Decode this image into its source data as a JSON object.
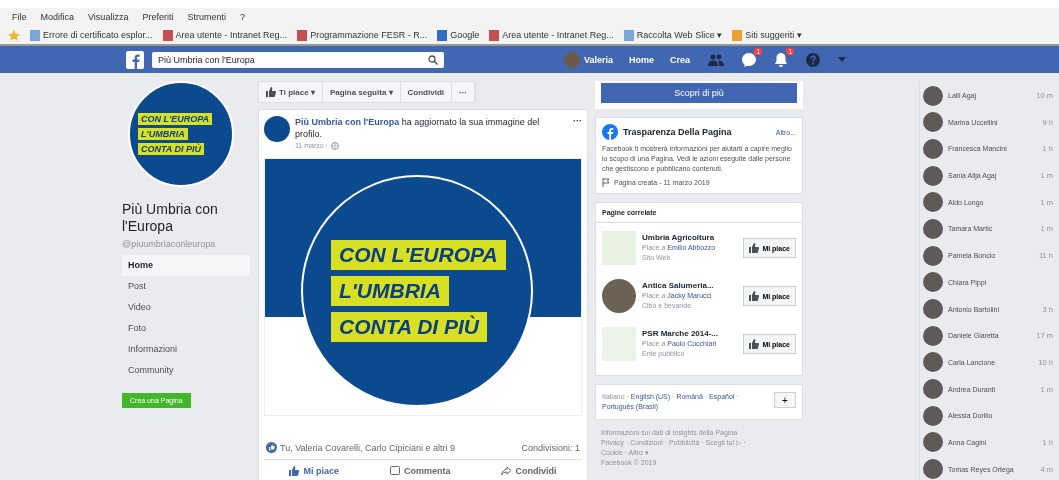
{
  "menu_bar": [
    "File",
    "Modifica",
    "Visualizza",
    "Preferiti",
    "Strumenti",
    "?"
  ],
  "favorites_bar": [
    {
      "kind": "page",
      "label": "Errore di certificato esplor..."
    },
    {
      "kind": "doc",
      "label": "Area utente - Intranet Reg..."
    },
    {
      "kind": "doc",
      "label": "Programmazione FESR - R..."
    },
    {
      "kind": "google",
      "label": "Google"
    },
    {
      "kind": "doc",
      "label": "Area utente - Intranet Reg..."
    },
    {
      "kind": "slice",
      "label": "Raccolta Web Slice ▾"
    },
    {
      "kind": "suggest",
      "label": "Siti suggeriti ▾"
    }
  ],
  "fb_bar": {
    "search": "Più Umbria con l'Europa",
    "user": "Valeria",
    "links": [
      "Home",
      "Crea"
    ],
    "messages_badge": "1",
    "notifications_badge": "1"
  },
  "page": {
    "logo_lines": [
      "CON L'EUROPA",
      "L'UMBRIA",
      "CONTA DI PIÙ"
    ],
    "name": "Più Umbria con l'Europa",
    "handle": "@piuumbriaconleuropa",
    "nav": [
      {
        "label": "Home",
        "selected": true
      },
      {
        "label": "Post",
        "selected": false
      },
      {
        "label": "Video",
        "selected": false
      },
      {
        "label": "Foto",
        "selected": false
      },
      {
        "label": "Informazioni",
        "selected": false
      },
      {
        "label": "Community",
        "selected": false
      }
    ],
    "create_button": "Crea una Pagina"
  },
  "actions": [
    "Ti piace ▾",
    "Pagina seguita ▾",
    "Condividi",
    "···"
  ],
  "post": {
    "image_lines": [
      "CON L'EUROPA",
      "L'UMBRIA",
      "CONTA DI PIÙ"
    ],
    "author": "Più Umbria con l'Europa",
    "text": " ha aggiornato la sua immagine del profilo.",
    "date": "11 marzo ·",
    "menu": "···",
    "reactions": "Tu, Valeria Covarelli, Carlo Cipiciani e altri 9",
    "shares": "Condivisioni: 1",
    "buttons": [
      "Mi piace",
      "Commenta",
      "Condividi"
    ]
  },
  "cta": "Scopri di più",
  "transparency": {
    "title": "Trasparenza Della Pagina",
    "more": "Altro...",
    "text": "Facebook ti mostrerà informazioni per aiutarti a capire meglio lo scopo di una Pagina. Vedi le azioni eseguite dalle persone che gestiscono e pubblicano contenuti.",
    "created": "Pagina creata - 11 marzo 2019"
  },
  "related": {
    "title": "Pagine correlate",
    "pages": [
      {
        "name": "Umbria Agricoltura",
        "liked_by": "Piace a ",
        "friend": "Emilio Abbozzo",
        "category": "Sito Web",
        "button": "Mi piace"
      },
      {
        "name": "Antica Salumeria...",
        "liked_by": "Piace a ",
        "friend": "Jacky Marucci",
        "category": "Cibo e bevande",
        "button": "Mi piace"
      },
      {
        "name": "PSR Marche 2014-...",
        "liked_by": "Piace a ",
        "friend": "Paolo Cucchiari",
        "category": "Ente pubblico",
        "button": "Mi piace"
      }
    ]
  },
  "languages": {
    "current": "Italiano",
    "separator": "·",
    "others": [
      "English (US)",
      "Română",
      "Español",
      "Português (Brasil)"
    ],
    "add": "+"
  },
  "footer": [
    "Informazioni sui dati di Insights della Pagina",
    "Privacy · Condizioni · Pubblicità · Scegli tu! ▷ ·",
    "Cookie · Altro ▾",
    "Facebook © 2019"
  ],
  "chat": [
    {
      "name": "Lalli Agaj",
      "time": "10 m"
    },
    {
      "name": "Marina Uccellini",
      "time": "9 h"
    },
    {
      "name": "Francesca Mancini",
      "time": "1 h"
    },
    {
      "name": "Sania Alija Agaj",
      "time": "1 m"
    },
    {
      "name": "Aldo Longo",
      "time": "1 m"
    },
    {
      "name": "Tamara Martic",
      "time": "1 m"
    },
    {
      "name": "Pamela Boncio",
      "time": "11 h"
    },
    {
      "name": "Chiara Pippi"
    },
    {
      "name": "Antonio Bartolini",
      "time": "3 h"
    },
    {
      "name": "Daniele Giaretta",
      "time": "17 m"
    },
    {
      "name": "Carla Lancione",
      "time": "10 h"
    },
    {
      "name": "Andrea Duranti",
      "time": "1 m"
    },
    {
      "name": "Alessia Dorilio"
    },
    {
      "name": "Anna Cagini",
      "time": "1 h"
    },
    {
      "name": "Tomas Reyes Ortega",
      "time": "4 m"
    }
  ]
}
